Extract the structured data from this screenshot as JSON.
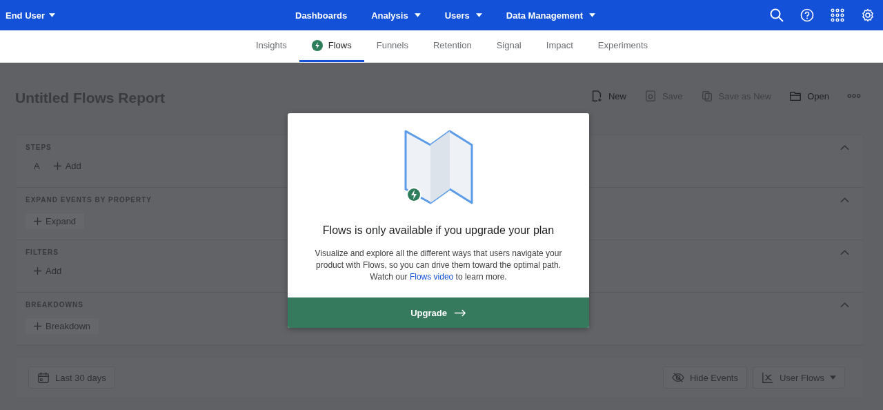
{
  "top_nav": {
    "workspace": "End User",
    "menu": [
      {
        "label": "Dashboards",
        "dropdown": false
      },
      {
        "label": "Analysis",
        "dropdown": true
      },
      {
        "label": "Users",
        "dropdown": true
      },
      {
        "label": "Data Management",
        "dropdown": true
      }
    ]
  },
  "tabs": [
    {
      "label": "Insights",
      "selected": false,
      "locked": false
    },
    {
      "label": "Flows",
      "selected": true,
      "locked": true
    },
    {
      "label": "Funnels",
      "selected": false,
      "locked": false
    },
    {
      "label": "Retention",
      "selected": false,
      "locked": false
    },
    {
      "label": "Signal",
      "selected": false,
      "locked": false
    },
    {
      "label": "Impact",
      "selected": false,
      "locked": false
    },
    {
      "label": "Experiments",
      "selected": false,
      "locked": false
    }
  ],
  "report": {
    "title": "Untitled Flows Report",
    "actions": [
      {
        "kind": "new",
        "label": "New",
        "disabled": false
      },
      {
        "kind": "save",
        "label": "Save",
        "disabled": true
      },
      {
        "kind": "copy",
        "label": "Save as New",
        "disabled": true
      },
      {
        "kind": "open",
        "label": "Open",
        "disabled": false
      },
      {
        "kind": "more"
      }
    ]
  },
  "sections": [
    {
      "heading": "STEPS",
      "expanded": true,
      "items": [
        {
          "kind": "letter",
          "label": "A"
        },
        {
          "kind": "add",
          "label": "Add"
        }
      ]
    },
    {
      "heading": "EXPAND EVENTS BY PROPERTY",
      "expanded": true,
      "items": [
        {
          "kind": "button",
          "label": "Expand"
        }
      ]
    },
    {
      "heading": "FILTERS",
      "expanded": true,
      "items": [
        {
          "kind": "add",
          "label": "Add"
        }
      ]
    },
    {
      "heading": "BREAKDOWNS",
      "expanded": true,
      "items": [
        {
          "kind": "button",
          "label": "Breakdown"
        }
      ]
    }
  ],
  "footer": {
    "date_range": "Last 30 days",
    "hide_events": "Hide Events",
    "view": "User Flows"
  },
  "modal": {
    "title": "Flows is only available if you upgrade your plan",
    "body_before": "Visualize and explore all the different ways that users navigate your product with Flows, so you can drive them toward the optimal path. Watch our ",
    "link": "Flows video",
    "body_after": " to learn more.",
    "button": "Upgrade"
  }
}
